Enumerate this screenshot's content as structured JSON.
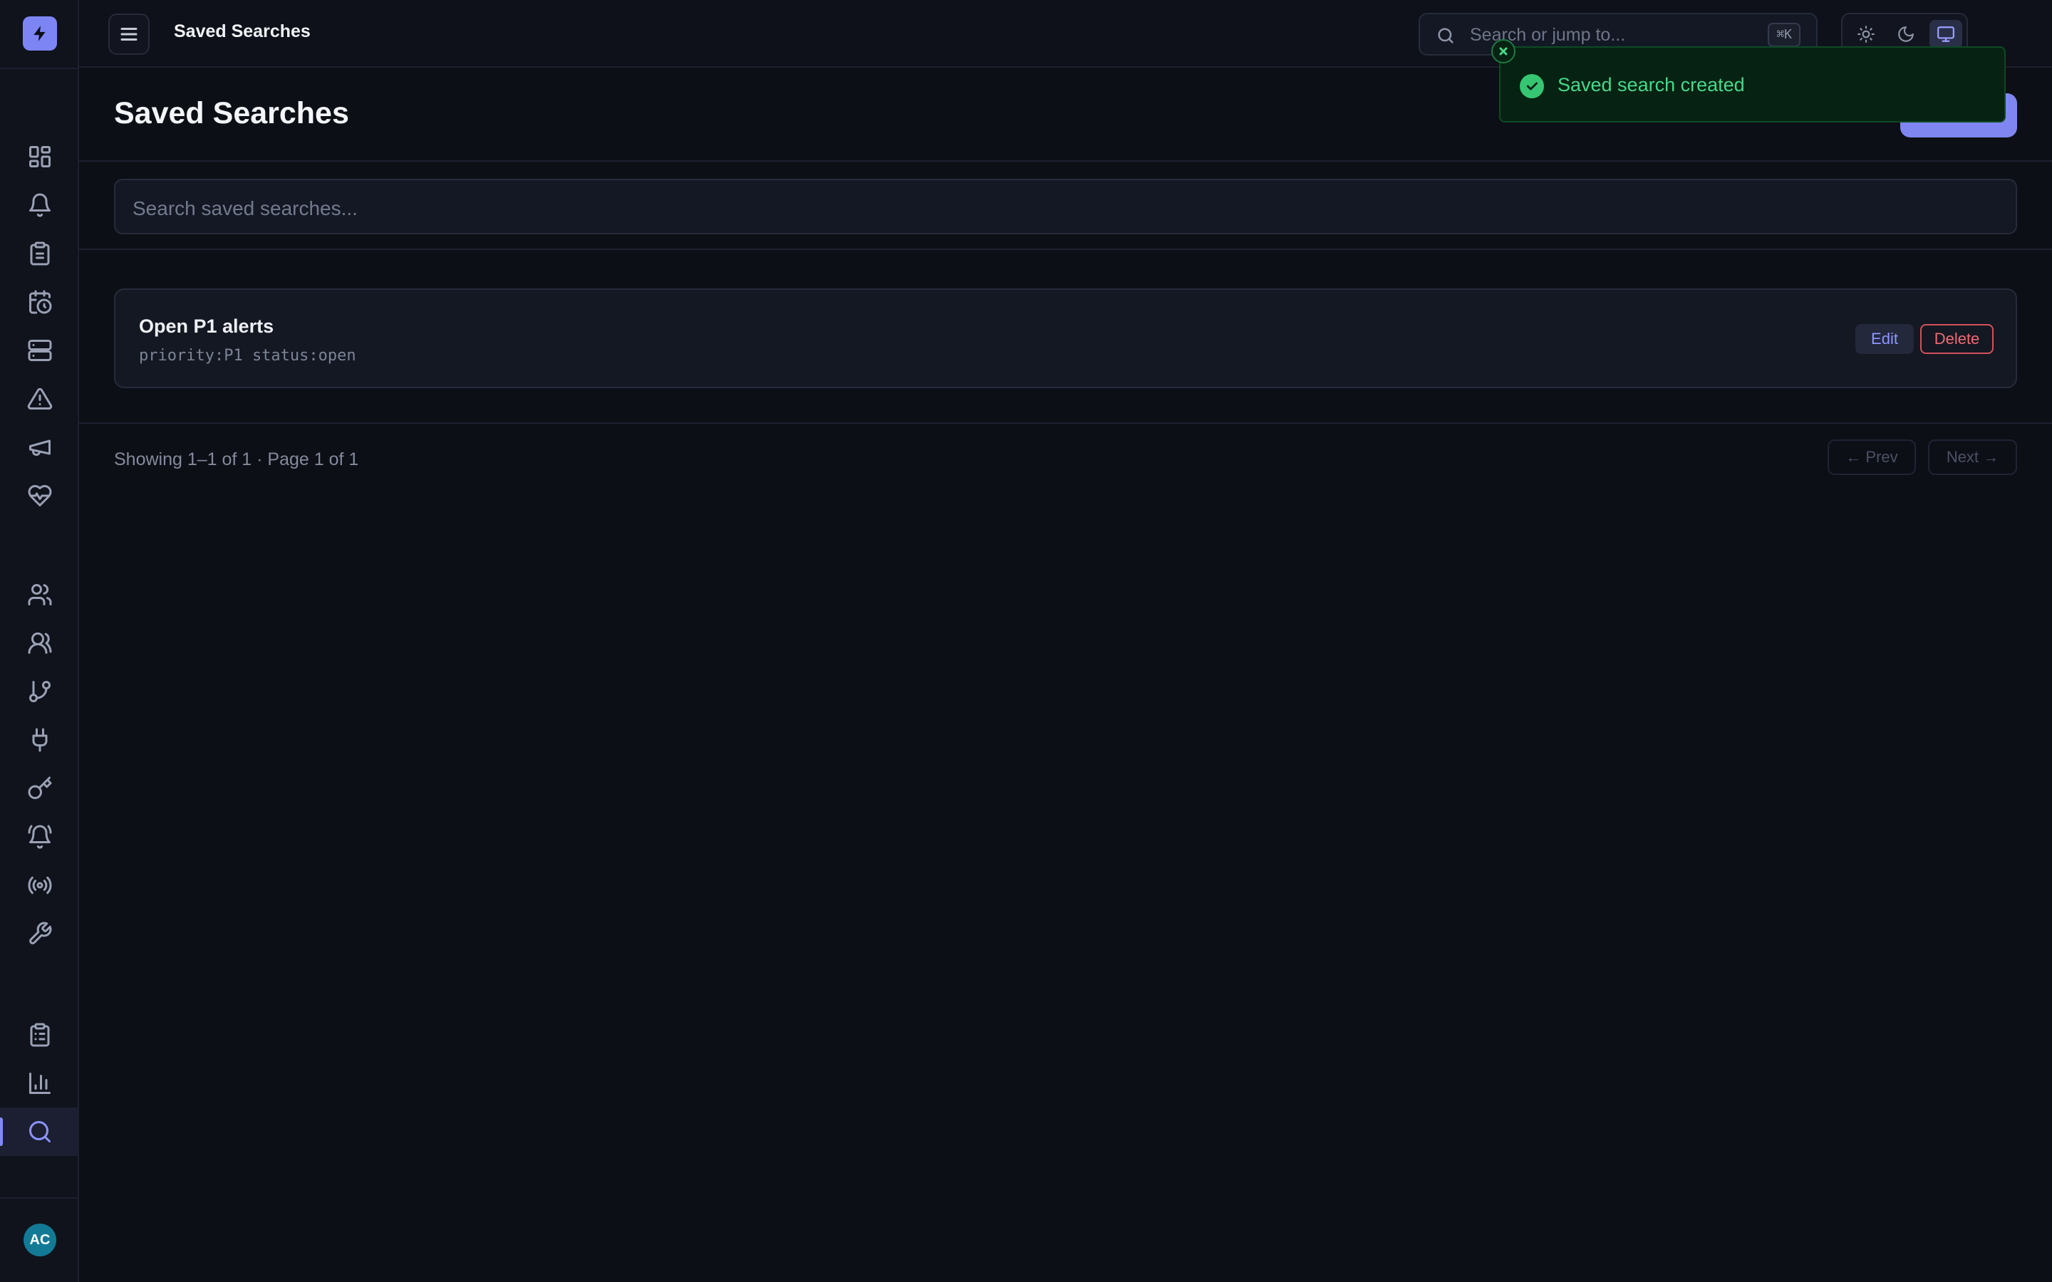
{
  "app": {
    "logo_icon": "bolt-icon",
    "accent_color": "#7d85f5"
  },
  "topbar": {
    "title": "Saved Searches",
    "search_placeholder": "Search or jump to...",
    "search_shortcut": "⌘K",
    "theme_options": [
      "light",
      "dark",
      "system"
    ],
    "theme_selected": "system",
    "avatar_initials": "AC"
  },
  "sidebar": {
    "nav_groups": [
      [
        "dashboard-icon",
        "bell-icon",
        "clipboard-icon",
        "calendar-clock-icon",
        "server-icon",
        "alert-triangle-icon",
        "megaphone-icon",
        "heart-pulse-icon"
      ],
      [
        "users-icon",
        "team-icon",
        "git-branch-icon",
        "plug-icon",
        "key-icon",
        "bell-ring-icon",
        "broadcast-icon",
        "wrench-icon"
      ],
      [
        "clipboard-list-icon",
        "bar-chart-icon",
        "search-icon"
      ]
    ],
    "active_item": "search-icon",
    "avatar_initials": "AC"
  },
  "page": {
    "title": "Saved Searches",
    "filter_placeholder": "Search saved searches..."
  },
  "saved_searches": [
    {
      "name": "Open P1 alerts",
      "query": "priority:P1 status:open",
      "edit_label": "Edit",
      "delete_label": "Delete"
    }
  ],
  "pagination": {
    "summary": "Showing 1–1 of 1 · Page 1 of 1",
    "prev_label": "← Prev",
    "next_label": "Next →"
  },
  "toast": {
    "message": "Saved search created",
    "status_color": "#36c672"
  }
}
